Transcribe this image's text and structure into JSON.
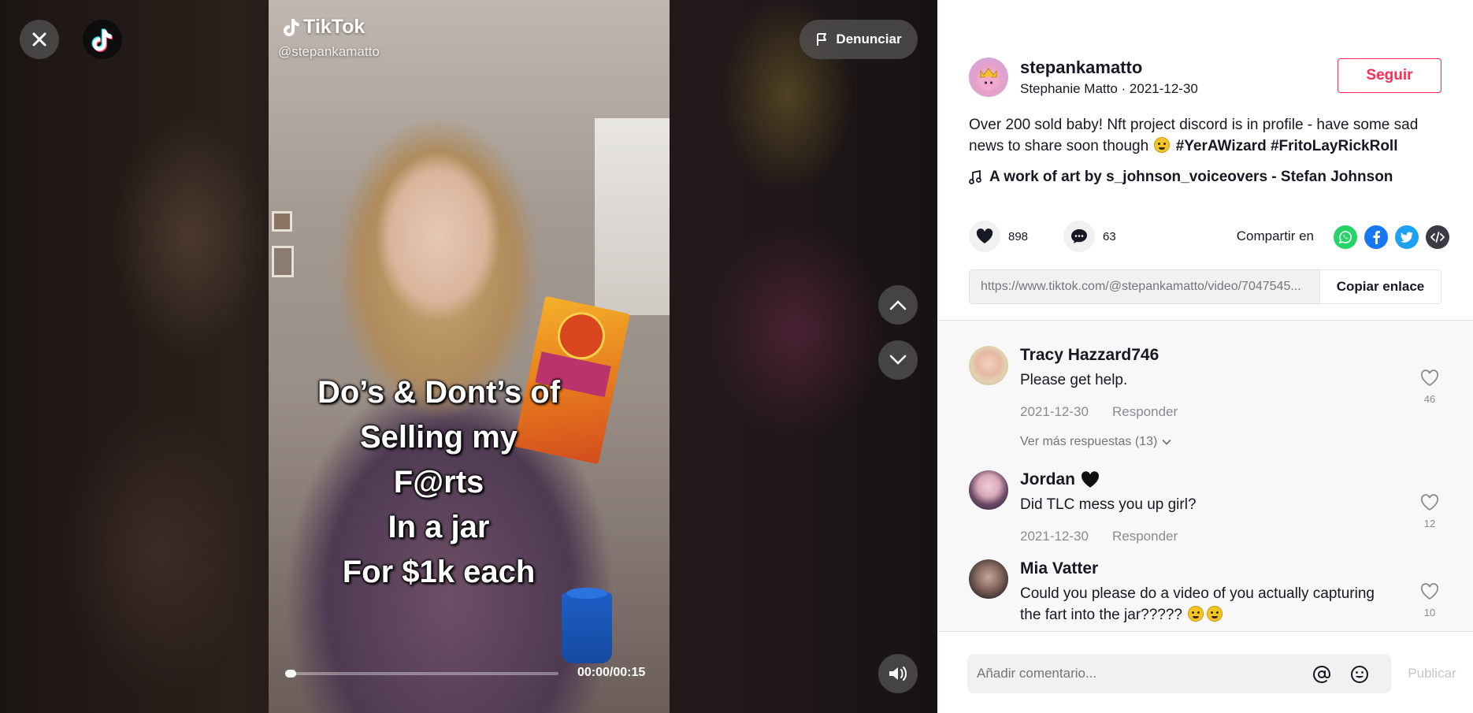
{
  "player": {
    "watermark_brand": "TikTok",
    "watermark_user": "@stepankamatto",
    "report_label": "Denunciar",
    "overlay_lines": [
      "Do’s & Dont’s of",
      "Selling my",
      "F@rts",
      "In a jar",
      "For $1k each"
    ],
    "time": "00:00/00:15",
    "progress": 0.04,
    "icons": {
      "close": "close-icon",
      "logo": "tiktok-logo-icon",
      "report": "flag-icon",
      "prev": "chevron-up-icon",
      "next": "chevron-down-icon",
      "volume": "volume-icon"
    }
  },
  "author": {
    "username": "stepankamatto",
    "subline": "Stephanie Matto · 2021-12-30",
    "follow_label": "Seguir"
  },
  "post": {
    "description": "Over 200 sold baby! Nft project discord is in profile - have some sad news to share soon though",
    "hashtags": [
      "#YerAWizard",
      "#FritoLayRickRoll"
    ],
    "music": "A work of art by s_johnson_voiceovers - Stefan Johnson"
  },
  "stats": {
    "likes": "898",
    "comments": "63",
    "share_label": "Compartir en"
  },
  "share": {
    "link": "https://www.tiktok.com/@stepankamatto/video/7047545...",
    "copy_label": "Copiar enlace",
    "targets": [
      "whatsapp-icon",
      "facebook-icon",
      "twitter-icon",
      "embed-icon"
    ]
  },
  "comments": [
    {
      "name": "Tracy Hazzard746",
      "text": "Please get help.",
      "date": "2021-12-30",
      "reply": "Responder",
      "likes": "46"
    },
    {
      "name": "Jordan",
      "text": "Did TLC mess you up girl?",
      "date": "2021-12-30",
      "reply": "Responder",
      "likes": "12"
    },
    {
      "name": "Mia Vatter",
      "text": "Could you please do a video of you actually capturing the fart into the jar?????",
      "likes": "10"
    }
  ],
  "more_replies": "Ver más respuestas (13)",
  "composer": {
    "placeholder": "Añadir comentario...",
    "post_label": "Publicar"
  },
  "colors": {
    "accent": "#fe2c55",
    "whatsapp": "#25d366",
    "facebook": "#1877f2",
    "twitter": "#1da1f2",
    "embed": "#3a3b44"
  }
}
